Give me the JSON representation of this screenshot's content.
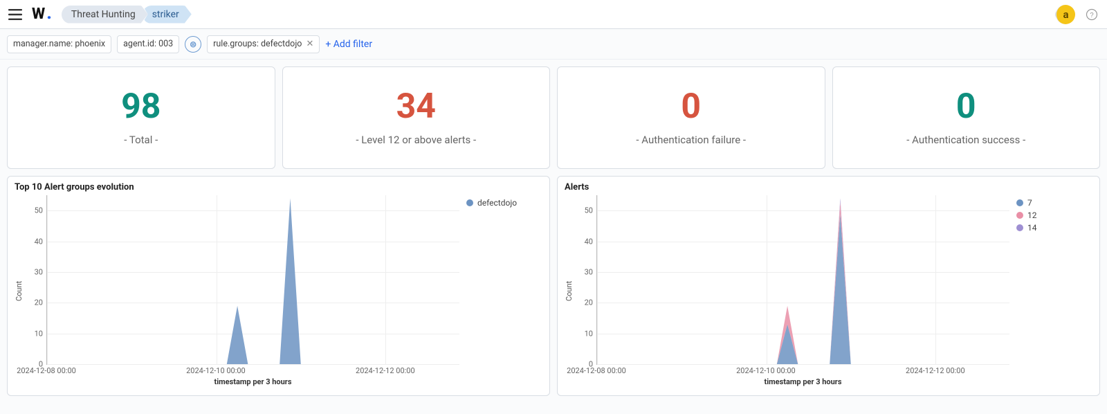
{
  "header": {
    "logo_letter": "W",
    "breadcrumbs": [
      {
        "label": "Threat Hunting",
        "active": false
      },
      {
        "label": "striker",
        "active": true
      }
    ],
    "avatar_letter": "a"
  },
  "filters": {
    "chips": [
      {
        "label": "manager.name: phoenix",
        "closable": false
      },
      {
        "label": "agent.id: 003",
        "closable": false
      },
      {
        "label": "rule.groups: defectdojo",
        "closable": true
      }
    ],
    "operator_glyph": "⊜",
    "add_filter_label": "+ Add filter"
  },
  "stats": [
    {
      "value": "98",
      "label": "- Total -",
      "tone": "teal"
    },
    {
      "value": "34",
      "label": "- Level 12 or above alerts -",
      "tone": "coral"
    },
    {
      "value": "0",
      "label": "- Authentication failure -",
      "tone": "coral"
    },
    {
      "value": "0",
      "label": "- Authentication success -",
      "tone": "teal"
    }
  ],
  "charts": {
    "left": {
      "title": "Top 10 Alert groups evolution",
      "ylabel": "Count",
      "xlabel": "timestamp per 3 hours",
      "legend": [
        {
          "name": "defectdojo",
          "color": "#6c93c2"
        }
      ],
      "x_tick_labels": [
        "2024-12-08 00:00",
        "2024-12-10 00:00",
        "2024-12-12 00:00"
      ]
    },
    "right": {
      "title": "Alerts",
      "ylabel": "Count",
      "xlabel": "timestamp per 3 hours",
      "legend": [
        {
          "name": "7",
          "color": "#6c93c2"
        },
        {
          "name": "12",
          "color": "#e98fa6"
        },
        {
          "name": "14",
          "color": "#9e8fd2"
        }
      ],
      "x_tick_labels": [
        "2024-12-08 00:00",
        "2024-12-10 00:00",
        "2024-12-12 00:00"
      ]
    }
  },
  "chart_data": [
    {
      "id": "top10-alert-groups",
      "type": "area",
      "title": "Top 10 Alert groups evolution",
      "xlabel": "timestamp per 3 hours",
      "ylabel": "Count",
      "ylim": [
        0,
        55
      ],
      "x_ticks": [
        "2024-12-08 00:00",
        "2024-12-10 00:00",
        "2024-12-12 00:00"
      ],
      "x": [
        0,
        1,
        2,
        3,
        4,
        5,
        6,
        7,
        8,
        9,
        10,
        11,
        12,
        13,
        14,
        15,
        16,
        17,
        18,
        19,
        20,
        21,
        22,
        23,
        24,
        25,
        26,
        27,
        28,
        29,
        30,
        31,
        32,
        33,
        34,
        35,
        36,
        37,
        38,
        39
      ],
      "x_tick_positions": [
        0,
        16,
        32
      ],
      "series": [
        {
          "name": "defectdojo",
          "color": "#6c93c2",
          "values": [
            0,
            0,
            0,
            0,
            0,
            0,
            0,
            0,
            0,
            0,
            0,
            0,
            0,
            0,
            0,
            0,
            0,
            0,
            19,
            0,
            0,
            0,
            0,
            54,
            0,
            0,
            0,
            0,
            0,
            0,
            0,
            0,
            0,
            0,
            0,
            0,
            0,
            0,
            0,
            0
          ]
        }
      ]
    },
    {
      "id": "alerts",
      "type": "area",
      "title": "Alerts",
      "xlabel": "timestamp per 3 hours",
      "ylabel": "Count",
      "ylim": [
        0,
        55
      ],
      "x_ticks": [
        "2024-12-08 00:00",
        "2024-12-10 00:00",
        "2024-12-12 00:00"
      ],
      "x": [
        0,
        1,
        2,
        3,
        4,
        5,
        6,
        7,
        8,
        9,
        10,
        11,
        12,
        13,
        14,
        15,
        16,
        17,
        18,
        19,
        20,
        21,
        22,
        23,
        24,
        25,
        26,
        27,
        28,
        29,
        30,
        31,
        32,
        33,
        34,
        35,
        36,
        37,
        38,
        39
      ],
      "x_tick_positions": [
        0,
        16,
        32
      ],
      "series": [
        {
          "name": "7",
          "color": "#6c93c2",
          "values": [
            0,
            0,
            0,
            0,
            0,
            0,
            0,
            0,
            0,
            0,
            0,
            0,
            0,
            0,
            0,
            0,
            0,
            0,
            13,
            0,
            0,
            0,
            0,
            49,
            0,
            0,
            0,
            0,
            0,
            0,
            0,
            0,
            0,
            0,
            0,
            0,
            0,
            0,
            0,
            0
          ]
        },
        {
          "name": "12",
          "color": "#e98fa6",
          "values": [
            0,
            0,
            0,
            0,
            0,
            0,
            0,
            0,
            0,
            0,
            0,
            0,
            0,
            0,
            0,
            0,
            0,
            0,
            6,
            0,
            0,
            0,
            0,
            4,
            0,
            0,
            0,
            0,
            0,
            0,
            0,
            0,
            0,
            0,
            0,
            0,
            0,
            0,
            0,
            0
          ]
        },
        {
          "name": "14",
          "color": "#9e8fd2",
          "values": [
            0,
            0,
            0,
            0,
            0,
            0,
            0,
            0,
            0,
            0,
            0,
            0,
            0,
            0,
            0,
            0,
            0,
            0,
            0,
            0,
            0,
            0,
            0,
            1,
            0,
            0,
            0,
            0,
            0,
            0,
            0,
            0,
            0,
            0,
            0,
            0,
            0,
            0,
            0,
            0
          ]
        }
      ]
    }
  ]
}
